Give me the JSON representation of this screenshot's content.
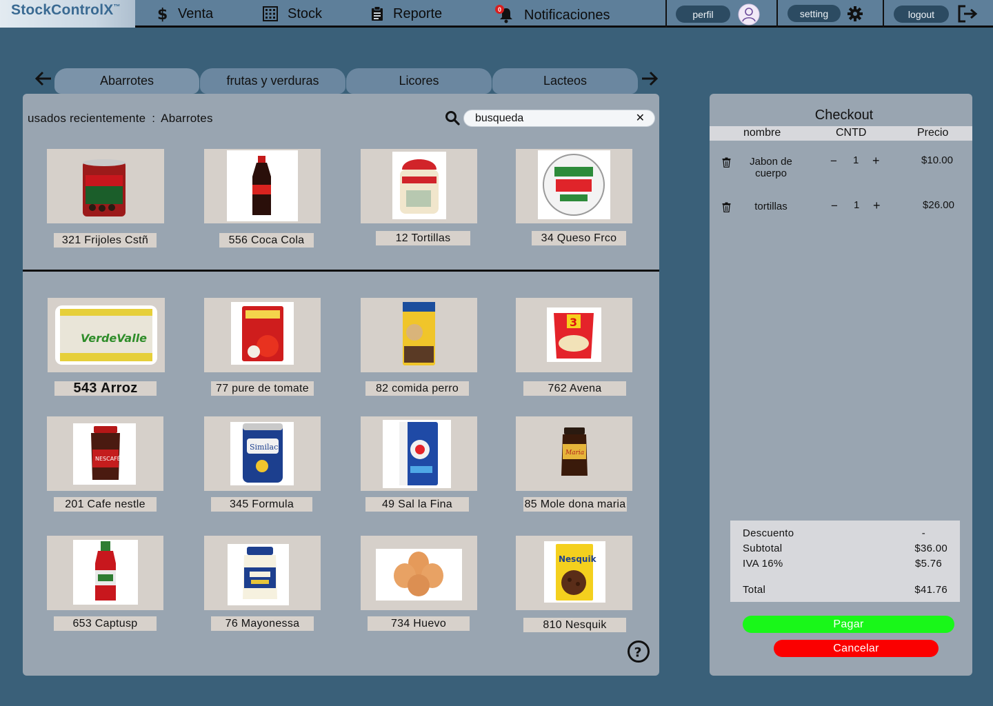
{
  "app": {
    "logo": "StockControlX",
    "logo_mark": "™"
  },
  "nav": {
    "items": [
      {
        "label": "Venta",
        "icon": "dollar-icon"
      },
      {
        "label": "Stock",
        "icon": "grid-icon"
      },
      {
        "label": "Reporte",
        "icon": "report-icon"
      },
      {
        "label": "Notificaciones",
        "icon": "bell-icon",
        "badge": "0"
      }
    ],
    "profile_label": "perfil",
    "setting_label": "setting",
    "logout_label": "logout"
  },
  "tabs": [
    {
      "label": "Abarrotes",
      "active": true
    },
    {
      "label": "frutas y verduras",
      "active": false
    },
    {
      "label": "Licores",
      "active": false
    },
    {
      "label": "Lacteos",
      "active": false
    }
  ],
  "products_panel": {
    "recent_prefix": "usados recientemente",
    "recent_separator": ":",
    "recent_category": "Abarrotes",
    "search_value": "",
    "search_placeholder": "busqueda",
    "clear_symbol": "✕"
  },
  "recent_products": [
    {
      "label": "321 Frijoles Cstñ",
      "icon": "bean-can-icon"
    },
    {
      "label": "556 Coca Cola",
      "icon": "soda-bottle-icon"
    },
    {
      "label": "12 Tortillas",
      "icon": "tortilla-bag-icon"
    },
    {
      "label": "34 Queso Frco",
      "icon": "cheese-tub-icon"
    }
  ],
  "products": [
    {
      "label": "543 Arroz",
      "icon": "rice-bag-icon"
    },
    {
      "label": "77 pure de tomate",
      "icon": "tomato-puree-icon"
    },
    {
      "label": "82 comida perro",
      "icon": "dog-food-icon"
    },
    {
      "label": "762 Avena",
      "icon": "oats-icon"
    },
    {
      "label": "201 Cafe nestle",
      "icon": "coffee-jar-icon"
    },
    {
      "label": "345 Formula",
      "icon": "formula-can-icon"
    },
    {
      "label": "49 Sal la Fina",
      "icon": "salt-bag-icon"
    },
    {
      "label": "85 Mole dona maria",
      "icon": "mole-jar-icon"
    },
    {
      "label": "653 Captusp",
      "icon": "ketchup-bottle-icon"
    },
    {
      "label": "76 Mayonessa",
      "icon": "mayo-jar-icon"
    },
    {
      "label": "734 Huevo",
      "icon": "eggs-icon"
    },
    {
      "label": "810 Nesquik",
      "icon": "cereal-box-icon"
    }
  ],
  "checkout": {
    "title": "Checkout",
    "headers": {
      "name": "nombre",
      "qty": "CNTD",
      "price": "Precio"
    },
    "items": [
      {
        "name": "Jabon de cuerpo",
        "qty": "1",
        "price": "$10.00",
        "minus": "−",
        "plus": "+"
      },
      {
        "name": "tortillas",
        "qty": "1",
        "price": "$26.00",
        "minus": "−",
        "plus": "+"
      }
    ],
    "summary": {
      "discount_label": "Descuento",
      "discount_value": "-",
      "subtotal_label": "Subtotal",
      "subtotal_value": "$36.00",
      "tax_label": "IVA 16%",
      "tax_value": "$5.76",
      "total_label": "Total",
      "total_value": "$41.76"
    },
    "pay_label": "Pagar",
    "cancel_label": "Cancelar"
  },
  "colors": {
    "background": "#3a6079",
    "topbar": "#5e7f9a",
    "panel": "#99a5b1",
    "card": "#d6d0ca",
    "pay": "#19f719",
    "cancel": "#fb0000"
  }
}
